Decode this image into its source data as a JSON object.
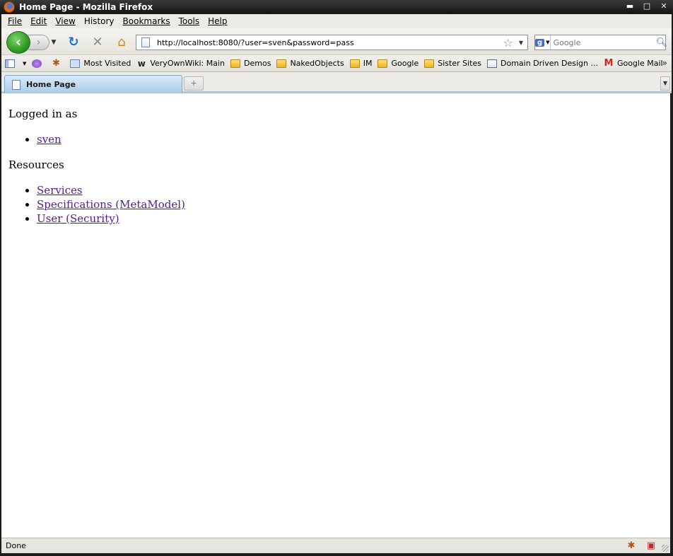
{
  "window": {
    "title": "Home Page - Mozilla Firefox",
    "controls": {
      "minimize": "▬",
      "maximize": "□",
      "close": "✕"
    }
  },
  "menubar": {
    "items": [
      {
        "label": "File",
        "accel": "F"
      },
      {
        "label": "Edit",
        "accel": "E"
      },
      {
        "label": "View",
        "accel": "V"
      },
      {
        "label": "History",
        "accel": "s"
      },
      {
        "label": "Bookmarks",
        "accel": "B"
      },
      {
        "label": "Tools",
        "accel": "T"
      },
      {
        "label": "Help",
        "accel": "H"
      }
    ]
  },
  "navbar": {
    "url": "http://localhost:8080/?user=sven&password=pass",
    "search_placeholder": "Google",
    "search_engine": "Google"
  },
  "bookmarks": {
    "items": [
      {
        "label": "",
        "icon": "sidebar-icon"
      },
      {
        "label": "",
        "icon": "purple-addon-icon"
      },
      {
        "label": "",
        "icon": "firebug-icon"
      },
      {
        "label": "Most Visited",
        "icon": "page-icon"
      },
      {
        "label": "VeryOwnWiki: Main",
        "icon": "wiki-icon"
      },
      {
        "label": "Demos",
        "icon": "folder-icon"
      },
      {
        "label": "NakedObjects",
        "icon": "folder-icon"
      },
      {
        "label": "IM",
        "icon": "folder-icon"
      },
      {
        "label": "Google",
        "icon": "folder-icon"
      },
      {
        "label": "Sister Sites",
        "icon": "folder-icon"
      },
      {
        "label": "Domain Driven Design ...",
        "icon": "document-icon"
      },
      {
        "label": "Google Mail",
        "icon": "gmail-icon"
      }
    ],
    "overflow": "»"
  },
  "tabs": {
    "items": [
      {
        "label": "Home Page",
        "active": true
      }
    ]
  },
  "content": {
    "logged_in_heading": "Logged in as",
    "user_links": [
      "sven"
    ],
    "resources_heading": "Resources",
    "resource_links": [
      "Services",
      "Specifications (MetaModel)",
      "User (Security)"
    ]
  },
  "statusbar": {
    "text": "Done"
  },
  "colors": {
    "link_visited": "#551a8b",
    "tab_active": "#a8cbeb",
    "chrome_bg": "#eceae4"
  }
}
